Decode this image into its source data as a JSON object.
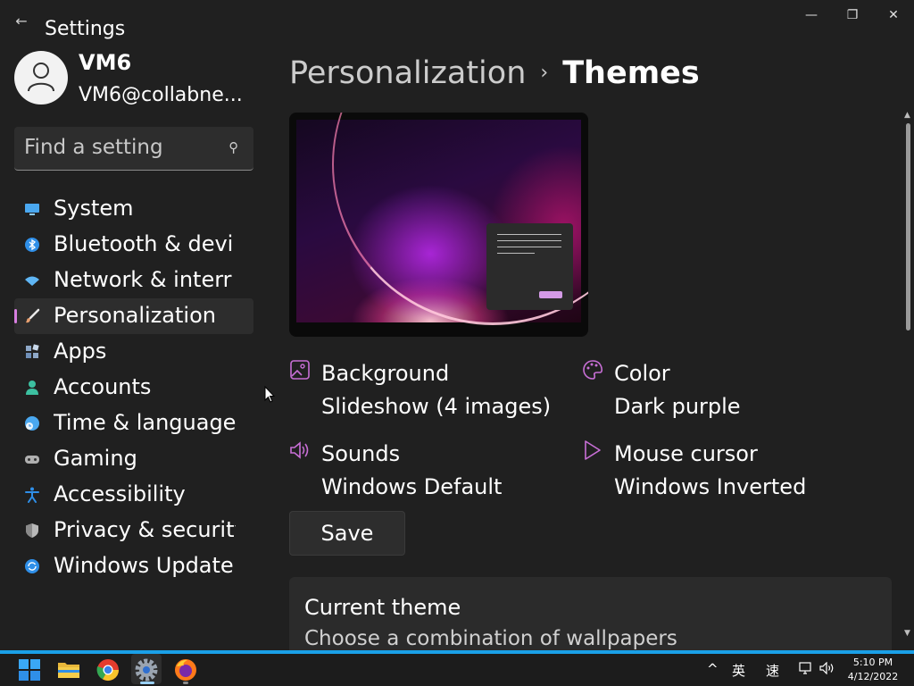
{
  "app": {
    "title": "Settings",
    "back_glyph": "←"
  },
  "window_controls": {
    "minimize": "—",
    "maximize": "❐",
    "close": "✕"
  },
  "user": {
    "name": "VM6",
    "email": "VM6@collabne..."
  },
  "search": {
    "placeholder": "Find a setting",
    "icon": "search-icon"
  },
  "nav": {
    "items": [
      {
        "label": "System",
        "icon": "monitor-icon",
        "color": "#4aa8f0"
      },
      {
        "label": "Bluetooth & devi",
        "icon": "bluetooth-icon",
        "color": "#2f8fe8"
      },
      {
        "label": "Network & interr",
        "icon": "wifi-icon",
        "color": "#5fb6f5"
      },
      {
        "label": "Personalization",
        "icon": "paintbrush-icon",
        "color": "#e8a070",
        "active": true
      },
      {
        "label": "Apps",
        "icon": "apps-icon",
        "color": "#8ea8c8"
      },
      {
        "label": "Accounts",
        "icon": "person-icon",
        "color": "#3cc0a0"
      },
      {
        "label": "Time & language",
        "icon": "clock-globe-icon",
        "color": "#4aa8f0"
      },
      {
        "label": "Gaming",
        "icon": "gamepad-icon",
        "color": "#b0b0b0"
      },
      {
        "label": "Accessibility",
        "icon": "accessibility-icon",
        "color": "#2f8fe8"
      },
      {
        "label": "Privacy & security",
        "icon": "shield-icon",
        "color": "#b8b8b8"
      },
      {
        "label": "Windows Update",
        "icon": "update-icon",
        "color": "#2f8fe8"
      }
    ],
    "accent": "#d77ee0"
  },
  "breadcrumb": {
    "parent": "Personalization",
    "separator": "›",
    "current": "Themes"
  },
  "theme_props": {
    "background": {
      "title": "Background",
      "value": "Slideshow (4 images)",
      "icon": "image-icon"
    },
    "color": {
      "title": "Color",
      "value": "Dark purple",
      "icon": "palette-icon"
    },
    "sounds": {
      "title": "Sounds",
      "value": "Windows Default",
      "icon": "speaker-icon"
    },
    "cursor": {
      "title": "Mouse cursor",
      "value": "Windows Inverted",
      "icon": "cursor-icon"
    },
    "icon_color": "#c86fd6"
  },
  "save_button": {
    "label": "Save"
  },
  "current_theme": {
    "title": "Current theme",
    "description": "Choose a combination of wallpapers"
  },
  "taskbar": {
    "apps": [
      "windows-start-icon",
      "file-explorer-icon",
      "chrome-icon",
      "settings-icon",
      "firefox-icon"
    ],
    "tray": {
      "chevron": "^",
      "ime_lang": "英",
      "ime_mode": "速"
    },
    "clock": {
      "time": "5:10 PM",
      "date": "4/12/2022"
    },
    "accent": "#1aa0e8"
  }
}
